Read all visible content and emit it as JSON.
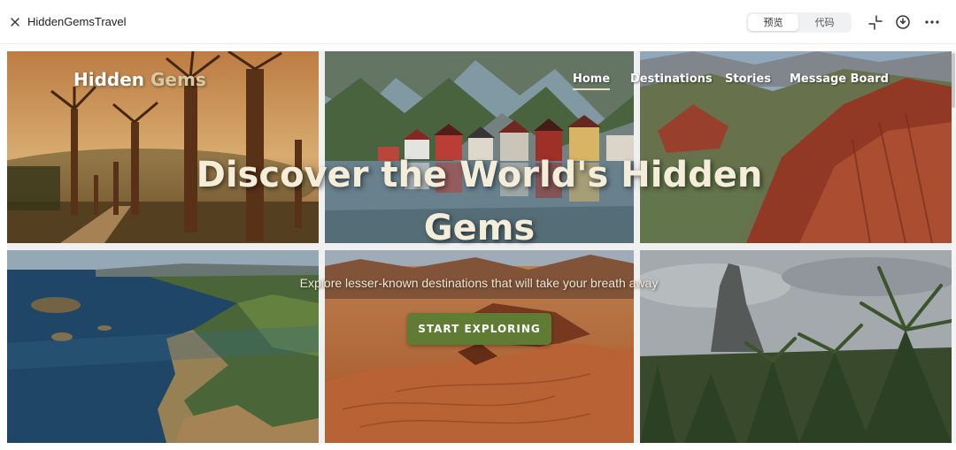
{
  "window": {
    "title": "HiddenGemsTravel",
    "tabs": [
      "预览",
      "代码"
    ],
    "active_tab": "预览",
    "icons": [
      "close-icon",
      "collapse-icon",
      "history-icon",
      "more-icon"
    ]
  },
  "site": {
    "logo_part1": "Hidden",
    "logo_part2": "Gems",
    "nav": [
      "Home",
      "Destinations",
      "Stories",
      "Message Board"
    ],
    "active_nav": "Home",
    "hero_title": "Discover the World's Hidden Gems",
    "hero_subtitle": "Explore lesser-known destinations that will take your breath away",
    "cta_label": "START EXPLORING",
    "colors": {
      "accent": "#5f7b34",
      "logo_accent": "#d9c9a3",
      "headline": "#f3edd9"
    },
    "images": [
      "baobab-avenue-sunset",
      "fjord-village-mountains",
      "red-rock-canyon",
      "rocky-coastline",
      "desert-red-sand-dunes",
      "volcanic-peak-palm-forest"
    ]
  }
}
